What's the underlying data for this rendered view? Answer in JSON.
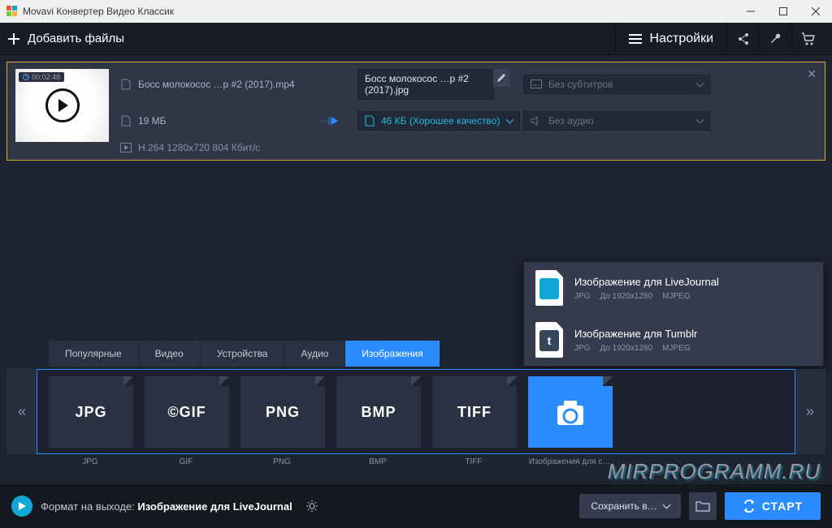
{
  "window": {
    "title": "Movavi Конвертер Видео Классик"
  },
  "toolbar": {
    "add_files": "Добавить файлы",
    "settings": "Настройки"
  },
  "file": {
    "duration": "00:02:48",
    "src_name": "Босс молокосос …р #2 (2017).mp4",
    "src_size": "19 МБ",
    "src_spec": "H.264 1280x720 804 Кбит/с",
    "tgt_name": "Босс молокосос …р #2 (2017).jpg",
    "tgt_quality": "46 КБ (Хорошее качество)",
    "subtitles_placeholder": "Без субтитров",
    "audio_placeholder": "Без аудио"
  },
  "presets": [
    {
      "title": "Изображение для LiveJournal",
      "fmt": "JPG",
      "res": "До 1920x1280",
      "codec": "MJPEG",
      "accent": "#0fa8d6"
    },
    {
      "title": "Изображение для Tumblr",
      "fmt": "JPG",
      "res": "До 1920x1280",
      "codec": "MJPEG",
      "accent": "#35465c"
    }
  ],
  "tabs": [
    "Популярные",
    "Видео",
    "Устройства",
    "Аудио",
    "Изображения"
  ],
  "active_tab": 4,
  "formats": [
    {
      "code": "JPG",
      "label": "JPG"
    },
    {
      "code": "GIF",
      "label": "GIF",
      "copyright": true
    },
    {
      "code": "PNG",
      "label": "PNG"
    },
    {
      "code": "BMP",
      "label": "BMP"
    },
    {
      "code": "TIFF",
      "label": "TIFF"
    },
    {
      "code": "",
      "label": "Изображения для с…",
      "active": true,
      "icon": "camera"
    }
  ],
  "bottom": {
    "out_label": "Формат на выходе:",
    "out_value": "Изображение для LiveJournal",
    "save_in": "Сохранить в…",
    "start": "СТАРТ"
  },
  "watermark": "MIRPROGRAMM.RU"
}
